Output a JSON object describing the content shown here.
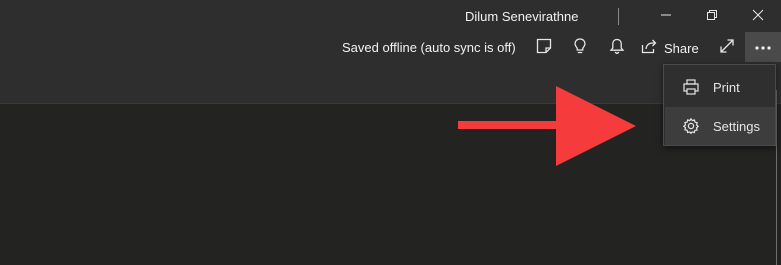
{
  "titlebar": {
    "user_name": "Dilum Senevirathne",
    "window_controls": [
      "minimize-icon",
      "restore-icon",
      "close-icon"
    ]
  },
  "toolbar": {
    "status": "Saved offline (auto sync is off)",
    "share_label": "Share",
    "icons": [
      "notes-icon",
      "lightbulb-icon",
      "bell-icon",
      "share-icon",
      "fullscreen-icon",
      "more-icon"
    ]
  },
  "menu": {
    "items": [
      {
        "label": "Print",
        "icon": "printer-icon"
      },
      {
        "label": "Settings",
        "icon": "gear-icon",
        "highlighted": true
      }
    ]
  },
  "annotation": {
    "arrow_color": "#f53b3b"
  },
  "colors": {
    "titlebar_bg": "#2e2e2e",
    "content_bg": "#232322",
    "menu_bg": "#2f2f2f",
    "highlight_bg": "#3d3d3d"
  }
}
